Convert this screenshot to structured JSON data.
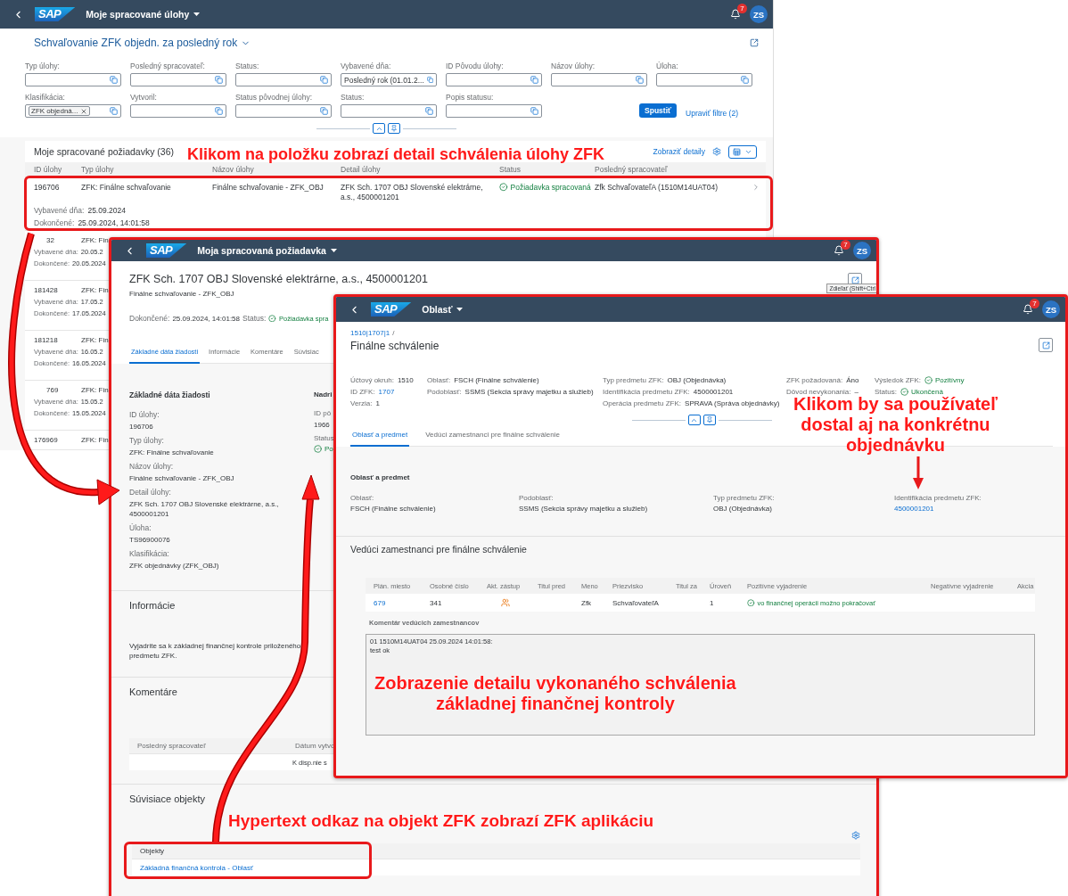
{
  "list_app": {
    "shell": {
      "logo": "SAP",
      "title": "Moje spracované úlohy",
      "notifications": "7",
      "avatar": "ZS"
    },
    "variant_title": "Schvaľovanie ZFK objedn. za posledný rok",
    "filters": [
      {
        "label": "Typ úlohy:"
      },
      {
        "label": "Posledný spracovateľ:"
      },
      {
        "label": "Status:"
      },
      {
        "label": "Vybavené dňa:",
        "value": "Posledný rok (01.01.2..."
      },
      {
        "label": "ID Pôvodu úlohy:"
      },
      {
        "label": "Názov úlohy:"
      },
      {
        "label": "Úloha:"
      },
      {
        "label": "Klasifikácia:",
        "token": "ZFK objedná..."
      },
      {
        "label": "Vytvoril:"
      },
      {
        "label": "Status pôvodnej úlohy:"
      },
      {
        "label": "Status:"
      },
      {
        "label": "Popis statusu:"
      }
    ],
    "go_button": "Spustiť",
    "adapt_filters": "Upraviť filtre (2)",
    "list": {
      "title": "Moje spracované požiadavky (36)",
      "show_details": "Zobraziť detaily",
      "columns": [
        "ID úlohy",
        "Typ úlohy",
        "Názov úlohy",
        "Detail úlohy",
        "Status",
        "Posledný spracovateľ"
      ],
      "rows": [
        {
          "id": "196706",
          "type": "ZFK: Finálne schvaľovanie",
          "name": "Finálne schvaľovanie - ZFK_OBJ",
          "detail": "ZFK Sch. 1707 OBJ Slovenské elektrárne, a.s., 4500001201",
          "status": "Požiadavka spracovaná",
          "processor": "Zfk SchvaľovateľA (1510M14UAT04)",
          "done_label": "Vybavené dňa:",
          "done": "25.09.2024",
          "finished_label": "Dokončené:",
          "finished": "25.09.2024, 14:01:58"
        }
      ],
      "partial_rows": [
        {
          "id": "32",
          "type": "ZFK: Fin",
          "done_label": "Vybavené dňa:",
          "done": "20.05.2",
          "finished_label": "Dokončené:",
          "finished": "20.05.2024"
        },
        {
          "id": "181428",
          "type": "ZFK: Fin",
          "done_label": "Vybavené dňa:",
          "done": "17.05.2",
          "finished_label": "Dokončené:",
          "finished": "17.05.2024"
        },
        {
          "id": "181218",
          "type": "ZFK: Fin",
          "done_label": "Vybavené dňa:",
          "done": "16.05.2",
          "finished_label": "Dokončené:",
          "finished": "16.05.2024"
        },
        {
          "id": "769",
          "type": "ZFK: Fin",
          "done_label": "Vybavené dňa:",
          "done": "15.05.2",
          "finished_label": "Dokončené:",
          "finished": "15.05.2024"
        },
        {
          "id": "176969",
          "type": "ZFK: Fin"
        }
      ]
    }
  },
  "request_app": {
    "shell": {
      "logo": "SAP",
      "title": "Moja spracovaná požiadavka",
      "notifications": "7",
      "avatar": "ZS"
    },
    "title": "ZFK Sch. 1707 OBJ Slovenské elektrárne, a.s., 4500001201",
    "subtitle": "Finálne schvaľovanie - ZFK_OBJ",
    "tooltip": "Zdieľať (Shift+Ctrl",
    "completed_label": "Dokončené:",
    "completed": "25.09.2024, 14:01:58",
    "status_label": "Status:",
    "status": "Požiadavka spra",
    "tabs": [
      {
        "label": "Základné dáta žiadosti",
        "selected": true
      },
      {
        "label": "Informácie",
        "selected": false
      },
      {
        "label": "Komentáre",
        "selected": false
      },
      {
        "label": "Súvisiac",
        "selected": false
      }
    ],
    "section_title": "Základné dáta žiadosti",
    "fields": [
      {
        "label": "ID úlohy:",
        "value": "196706"
      },
      {
        "label": "Typ úlohy:",
        "value": "ZFK: Finálne schvaľovanie"
      },
      {
        "label": "Názov úlohy:",
        "value": "Finálne schvaľovanie - ZFK_OBJ"
      },
      {
        "label": "Detail úlohy:",
        "value": "ZFK Sch. 1707 OBJ Slovenské elektrárne, a.s., 4500001201"
      },
      {
        "label": "Úloha:",
        "value": "TS96900076"
      },
      {
        "label": "Klasifikácia:",
        "value": "ZFK objednávky (ZFK_OBJ)"
      }
    ],
    "side_title": "Nadri",
    "side_fields": [
      {
        "label": "ID pô",
        "value": "1966"
      },
      {
        "label": "Status",
        "status": "Po"
      }
    ],
    "info": {
      "title": "Informácie",
      "text": "Vyjadrite sa k základnej finančnej kontrole priloženého predmetu ZFK."
    },
    "comments": {
      "title": "Komentáre",
      "columns": [
        "Posledný spracovateľ",
        "Dátum vytvo"
      ],
      "empty": "K disp.nie s"
    },
    "related": {
      "title": "Súvisiace objekty",
      "column": "Objekty",
      "link": "Základná finančná kontrola - Oblasť"
    }
  },
  "area_app": {
    "shell": {
      "logo": "SAP",
      "title": "Oblasť",
      "notifications": "7",
      "avatar": "ZS"
    },
    "breadcrumb": "1510|1707|1",
    "breadcrumb_separator": "/",
    "title": "Finálne schválenie",
    "header_columns": [
      [
        {
          "label": "Účtový okruh:",
          "value": "1510",
          "kind": "text"
        },
        {
          "label": "ID ZFK:",
          "value": "1707",
          "kind": "link"
        },
        {
          "label": "Verzia:",
          "value": "1",
          "kind": "text"
        }
      ],
      [
        {
          "label": "Oblasť:",
          "value": "FSCH (Finálne schválenie)",
          "kind": "text"
        },
        {
          "label": "Podoblasť:",
          "value": "SSMS (Sekcia správy majetku a služieb)",
          "kind": "text"
        }
      ],
      [
        {
          "label": "Typ predmetu ZFK:",
          "value": "OBJ (Objednávka)",
          "kind": "text"
        },
        {
          "label": "Identifikácia predmetu ZFK:",
          "value": "4500001201",
          "kind": "text"
        },
        {
          "label": "Operácia predmetu ZFK:",
          "value": "SPRAVA (Správa objednávky)",
          "kind": "text"
        }
      ],
      [
        {
          "label": "ZFK požadovaná:",
          "value": "Áno",
          "kind": "text"
        },
        {
          "label": "Dôvod nevykonania:",
          "value": "–",
          "kind": "text"
        }
      ],
      [
        {
          "label": "Výsledok ZFK:",
          "value": "Pozitívny",
          "kind": "status"
        },
        {
          "label": "Status:",
          "value": "Ukončená",
          "kind": "status"
        }
      ]
    ],
    "tabs": [
      {
        "label": "Oblasť a predmet",
        "selected": true
      },
      {
        "label": "Vedúci zamestnanci pre finálne schválenie",
        "selected": false
      }
    ],
    "section_title": "Oblasť a predmet",
    "fields": [
      {
        "label": "Oblasť:",
        "value": "FSCH (Finálne schválenie)",
        "kind": "text"
      },
      {
        "label": "Podoblasť:",
        "value": "SSMS (Sekcia správy majetku a služieb)",
        "kind": "text"
      },
      {
        "label": "Typ predmetu ZFK:",
        "value": "OBJ (Objednávka)",
        "kind": "text"
      },
      {
        "label": "Identifikácia predmetu ZFK:",
        "value": "4500001201",
        "kind": "link"
      }
    ],
    "managers_title": "Vedúci zamestnanci pre finálne schválenie",
    "table": {
      "columns": [
        "Plán. miesto",
        "Osobné číslo",
        "Akt. zástup",
        "Titul pred",
        "Meno",
        "Priezvisko",
        "Titul za",
        "Úroveň",
        "Pozitívne vyjadrenie",
        "Negatívne vyjadrenie",
        "Akcia"
      ],
      "rows": [
        [
          {
            "kind": "link",
            "text": "679"
          },
          {
            "kind": "text",
            "text": "341"
          },
          {
            "kind": "icon"
          },
          {
            "kind": "empty"
          },
          {
            "kind": "text",
            "text": "Zfk"
          },
          {
            "kind": "text",
            "text": "SchvaľovateľA"
          },
          {
            "kind": "empty"
          },
          {
            "kind": "text",
            "text": "1"
          },
          {
            "kind": "status",
            "text": "vo finančnej operácii možno pokračovať"
          },
          {
            "kind": "empty"
          },
          {
            "kind": "empty"
          }
        ]
      ]
    },
    "comment_label": "Komentár vedúcich zamestnancov",
    "comment_lines": [
      "01 1510M14UAT04 25.09.2024 14:01:58:",
      "test ok"
    ]
  },
  "annotations": [
    {
      "text": "Klikom na položku zobrazí detail schválenia úlohy ZFK"
    },
    {
      "text": "Klikom by sa používateľ\ndostal aj na konkrétnu\nobjednávku"
    },
    {
      "text": "Zobrazenie detailu vykonaného schválenia\nzákladnej finančnej kontroly"
    },
    {
      "text": "Hypertext odkaz na objekt ZFK zobrazí ZFK aplikáciu"
    }
  ]
}
